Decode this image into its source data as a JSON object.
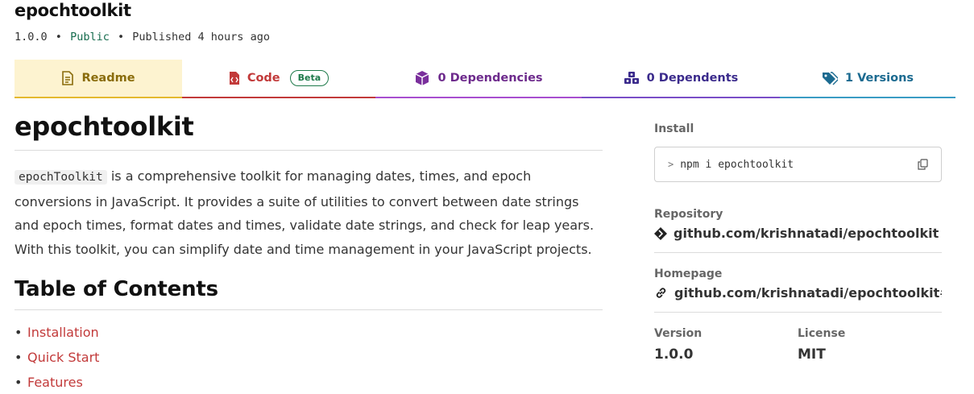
{
  "package": {
    "name": "epochtoolkit",
    "version": "1.0.0",
    "visibility": "Public",
    "published": "Published 4 hours ago",
    "separator": "•"
  },
  "tabs": {
    "readme": "Readme",
    "code": "Code",
    "code_badge": "Beta",
    "dependencies": "0 Dependencies",
    "dependents": "0 Dependents",
    "versions": "1 Versions"
  },
  "readme": {
    "title": "epochtoolkit",
    "intro_code": "epochToolkit",
    "intro_text": " is a comprehensive toolkit for managing dates, times, and epoch conversions in JavaScript. It provides a suite of utilities to convert between date strings and epoch times, format dates and times, validate date strings, and check for leap years. With this toolkit, you can simplify date and time management in your JavaScript projects.",
    "toc_heading": "Table of Contents",
    "toc_items": [
      "Installation",
      "Quick Start",
      "Features"
    ],
    "bullet": "•"
  },
  "sidebar": {
    "install_label": "Install",
    "install_prompt": ">",
    "install_command": "npm i epochtoolkit",
    "repository_label": "Repository",
    "repository_value": "github.com/krishnatadi/epochtoolkit",
    "homepage_label": "Homepage",
    "homepage_value": "github.com/krishnatadi/epochtoolkit#r...",
    "version_label": "Version",
    "version_value": "1.0.0",
    "license_label": "License",
    "license_value": "MIT"
  },
  "icons": {
    "readme": "file-text-icon",
    "code": "code-file-icon",
    "dependencies": "package-box-icon",
    "dependents": "boxes-icon",
    "versions": "tags-icon",
    "copy": "copy-icon",
    "repository": "git-diamond-icon",
    "homepage": "link-icon"
  },
  "colors": {
    "readme": "#8a6c0b",
    "code": "#c23a3a",
    "dependencies": "#6d2a8c",
    "dependents": "#3b2b8c",
    "versions": "#1b6a90",
    "public": "#166c4e"
  }
}
